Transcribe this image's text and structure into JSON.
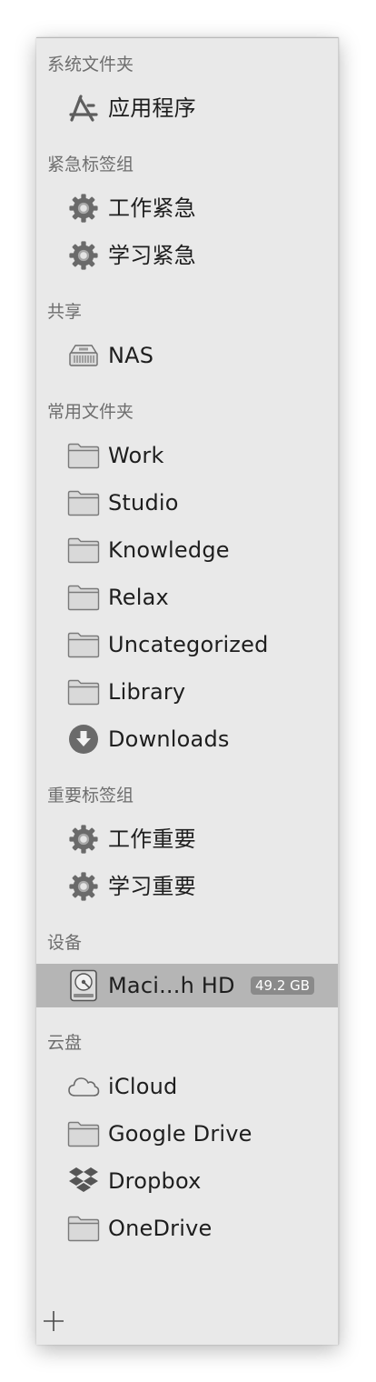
{
  "sidebar": {
    "sections": {
      "system": {
        "title": "系统文件夹",
        "items": [
          {
            "label": "应用程序",
            "icon": "applications-icon"
          }
        ]
      },
      "urgent": {
        "title": "紧急标签组",
        "items": [
          {
            "label": "工作紧急",
            "icon": "gear-icon"
          },
          {
            "label": "学习紧急",
            "icon": "gear-icon"
          }
        ]
      },
      "shared": {
        "title": "共享",
        "items": [
          {
            "label": "NAS",
            "icon": "nas-server-icon"
          }
        ]
      },
      "favorites": {
        "title": "常用文件夹",
        "items": [
          {
            "label": "Work",
            "icon": "folder-icon"
          },
          {
            "label": "Studio",
            "icon": "folder-icon"
          },
          {
            "label": "Knowledge",
            "icon": "folder-icon"
          },
          {
            "label": "Relax",
            "icon": "folder-icon"
          },
          {
            "label": "Uncategorized",
            "icon": "folder-icon"
          },
          {
            "label": "Library",
            "icon": "folder-icon"
          },
          {
            "label": "Downloads",
            "icon": "downloads-icon"
          }
        ]
      },
      "important": {
        "title": "重要标签组",
        "items": [
          {
            "label": "工作重要",
            "icon": "gear-icon"
          },
          {
            "label": "学习重要",
            "icon": "gear-icon"
          }
        ]
      },
      "devices": {
        "title": "设备",
        "items": [
          {
            "label": "Maci...h HD",
            "badge": "49.2 GB",
            "icon": "hard-drive-icon",
            "selected": true
          }
        ]
      },
      "cloud": {
        "title": "云盘",
        "items": [
          {
            "label": "iCloud",
            "icon": "cloud-icon"
          },
          {
            "label": "Google Drive",
            "icon": "folder-icon"
          },
          {
            "label": "Dropbox",
            "icon": "dropbox-icon"
          },
          {
            "label": "OneDrive",
            "icon": "folder-icon"
          }
        ]
      }
    },
    "footer": {
      "add_icon": "plus-icon"
    }
  }
}
